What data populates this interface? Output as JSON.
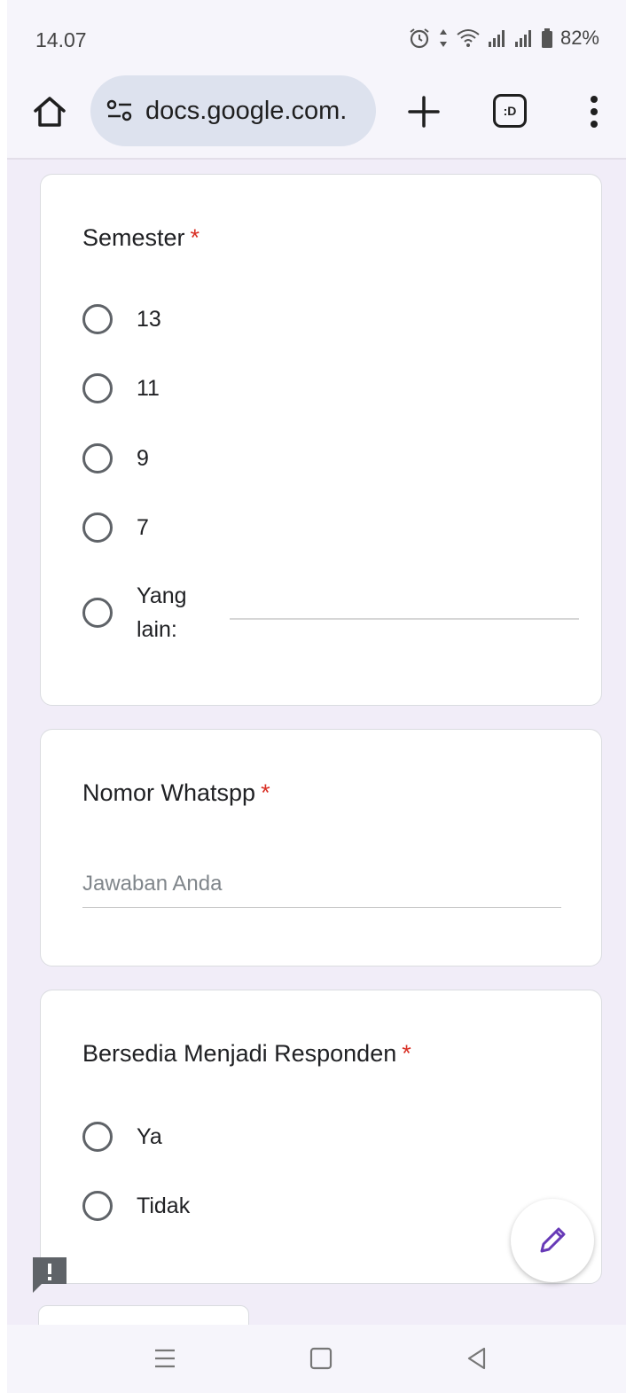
{
  "status_bar": {
    "time": "14.07",
    "battery": "82%",
    "icons": [
      "alarm-icon",
      "data-arrows-icon",
      "wifi-icon",
      "signal-icon",
      "signal-icon",
      "battery-icon"
    ]
  },
  "browser": {
    "url": "docs.google.com.",
    "icons": [
      "home-icon",
      "site-settings-icon",
      "plus-icon",
      "tabs-icon",
      "more-vert-icon"
    ],
    "tab_switcher_label": ":D"
  },
  "form": {
    "semester": {
      "title": "Semester",
      "required_mark": "*",
      "options": [
        "13",
        "11",
        "9",
        "7"
      ],
      "other_label": "Yang lain:",
      "other_value": ""
    },
    "whatsapp": {
      "title": "Nomor Whatspp",
      "required_mark": "*",
      "placeholder": "Jawaban Anda",
      "value": ""
    },
    "responden": {
      "title": "Bersedia Menjadi Responden",
      "required_mark": "*",
      "options": [
        "Ya",
        "Tidak"
      ]
    }
  },
  "colors": {
    "required": "#d93025",
    "page_background": "#f1edf8",
    "fab_icon": "#673ab7"
  }
}
